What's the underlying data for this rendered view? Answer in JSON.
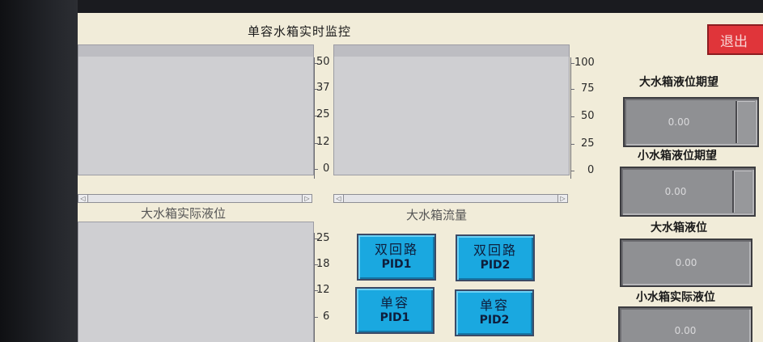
{
  "screen": {
    "title": "单容水箱实时监控",
    "exit_label": "退出"
  },
  "charts": {
    "big_level": {
      "label": "大水箱实际液位",
      "ticks": [
        "50",
        "37",
        "25",
        "12",
        "0"
      ]
    },
    "big_flow": {
      "label": "大水箱流量",
      "ticks": [
        "100",
        "75",
        "50",
        "25",
        "0"
      ]
    },
    "small_level": {
      "ticks": [
        "25",
        "18",
        "12",
        "6"
      ]
    }
  },
  "buttons": {
    "dual_pid1": {
      "line1": "双回路",
      "line2": "PID1"
    },
    "dual_pid2": {
      "line1": "双回路",
      "line2": "PID2"
    },
    "single_pid1": {
      "line1": "单容",
      "line2": "PID1"
    },
    "single_pid2": {
      "line1": "单容",
      "line2": "PID2"
    }
  },
  "panel": {
    "big_setpoint_label": "大水箱液位期望",
    "big_setpoint_value": "0.00",
    "small_setpoint_label": "小水箱液位期望",
    "small_setpoint_value": "0.00",
    "big_level_label": "大水箱液位",
    "big_level_value": "0.00",
    "small_level_label": "小水箱实际液位",
    "small_level_value": "0.00"
  },
  "icons": {
    "scroll_left": "◁",
    "scroll_right": "▷"
  }
}
